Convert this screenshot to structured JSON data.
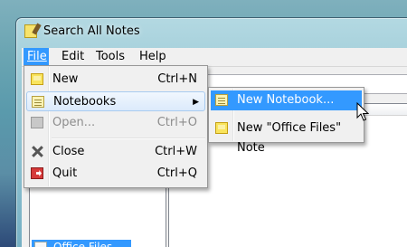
{
  "window": {
    "title": "Search All Notes",
    "app_icon": "notepad-icon"
  },
  "menubar": {
    "items": [
      {
        "label": "File",
        "active": true
      },
      {
        "label": "Edit",
        "active": false
      },
      {
        "label": "Tools",
        "active": false
      },
      {
        "label": "Help",
        "active": false
      }
    ]
  },
  "file_menu": {
    "items": [
      {
        "label": "New",
        "shortcut": "Ctrl+N",
        "icon": "new-note-icon",
        "enabled": true
      },
      {
        "label": "Notebooks",
        "shortcut": "",
        "icon": "notebook-icon",
        "enabled": true,
        "submenu": true,
        "highlighted": true
      },
      {
        "label": "Open...",
        "shortcut": "Ctrl+O",
        "icon": "open-icon",
        "enabled": false
      },
      {
        "label": "Close",
        "shortcut": "Ctrl+W",
        "icon": "close-icon",
        "enabled": true
      },
      {
        "label": "Quit",
        "shortcut": "Ctrl+Q",
        "icon": "quit-icon",
        "enabled": true
      }
    ]
  },
  "notebooks_submenu": {
    "items": [
      {
        "label": "New Notebook...",
        "icon": "notebook-icon",
        "highlighted": true
      },
      {
        "label": "New \"Office Files\" Note",
        "icon": "new-note-icon",
        "highlighted": false
      }
    ]
  },
  "tree": {
    "selected_item": "Office Files"
  },
  "colors": {
    "highlight": "#3399ff",
    "menu_bg": "#f0f0f0",
    "note_yellow": "#f9e45c"
  }
}
